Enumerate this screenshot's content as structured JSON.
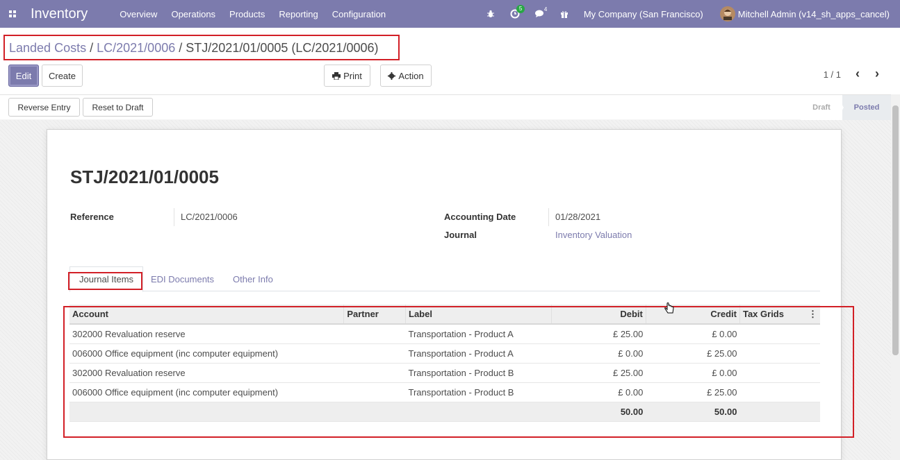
{
  "topbar": {
    "app_title": "Inventory",
    "menu": [
      "Overview",
      "Operations",
      "Products",
      "Reporting",
      "Configuration"
    ],
    "activity_count": "5",
    "messages_count": "4",
    "company": "My Company (San Francisco)",
    "user": "Mitchell Admin (v14_sh_apps_cancel)",
    "brand_color": "#7c7bad"
  },
  "breadcrumb": {
    "item1": "Landed Costs",
    "item2": "LC/2021/0006",
    "current": "STJ/2021/01/0005 (LC/2021/0006)",
    "sep": "/"
  },
  "actions": {
    "edit": "Edit",
    "create": "Create",
    "print": "Print",
    "action": "Action"
  },
  "pager": {
    "value": "1 / 1"
  },
  "statusbar": {
    "reverse": "Reverse Entry",
    "reset": "Reset to Draft",
    "stages": [
      "Draft",
      "Posted"
    ],
    "current_stage": "Posted"
  },
  "record": {
    "title": "STJ/2021/01/0005",
    "reference_label": "Reference",
    "reference_value": "LC/2021/0006",
    "date_label": "Accounting Date",
    "date_value": "01/28/2021",
    "journal_label": "Journal",
    "journal_value": "Inventory Valuation"
  },
  "tabs": [
    "Journal Items",
    "EDI Documents",
    "Other Info"
  ],
  "table": {
    "headers": [
      "Account",
      "Partner",
      "Label",
      "Debit",
      "Credit",
      "Tax Grids"
    ],
    "rows": [
      [
        "302000 Revaluation reserve",
        "",
        "Transportation - Product A",
        "£ 25.00",
        "£ 0.00",
        ""
      ],
      [
        "006000 Office equipment (inc computer equipment)",
        "",
        "Transportation - Product A",
        "£ 0.00",
        "£ 25.00",
        ""
      ],
      [
        "302000 Revaluation reserve",
        "",
        "Transportation - Product B",
        "£ 25.00",
        "£ 0.00",
        ""
      ],
      [
        "006000 Office equipment (inc computer equipment)",
        "",
        "Transportation - Product B",
        "£ 0.00",
        "£ 25.00",
        ""
      ]
    ],
    "total_debit": "50.00",
    "total_credit": "50.00"
  }
}
